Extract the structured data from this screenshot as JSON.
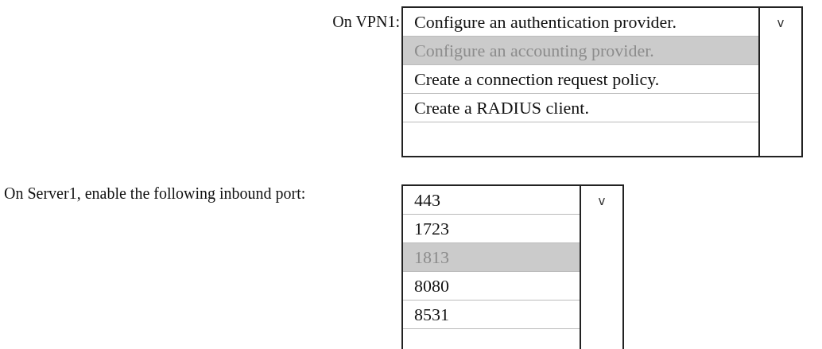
{
  "questions": [
    {
      "label": "On VPN1:",
      "arrow": "v",
      "options": [
        {
          "text": "Configure an authentication provider.",
          "selected": false
        },
        {
          "text": "Configure an accounting provider.",
          "selected": true
        },
        {
          "text": "Create a connection request policy.",
          "selected": false
        },
        {
          "text": "Create a RADIUS client.",
          "selected": false
        }
      ]
    },
    {
      "label": "On Server1, enable the following inbound port:",
      "arrow": "v",
      "options": [
        {
          "text": "443",
          "selected": false
        },
        {
          "text": "1723",
          "selected": false
        },
        {
          "text": "1813",
          "selected": true
        },
        {
          "text": "8080",
          "selected": false
        },
        {
          "text": "8531",
          "selected": false
        }
      ]
    }
  ]
}
